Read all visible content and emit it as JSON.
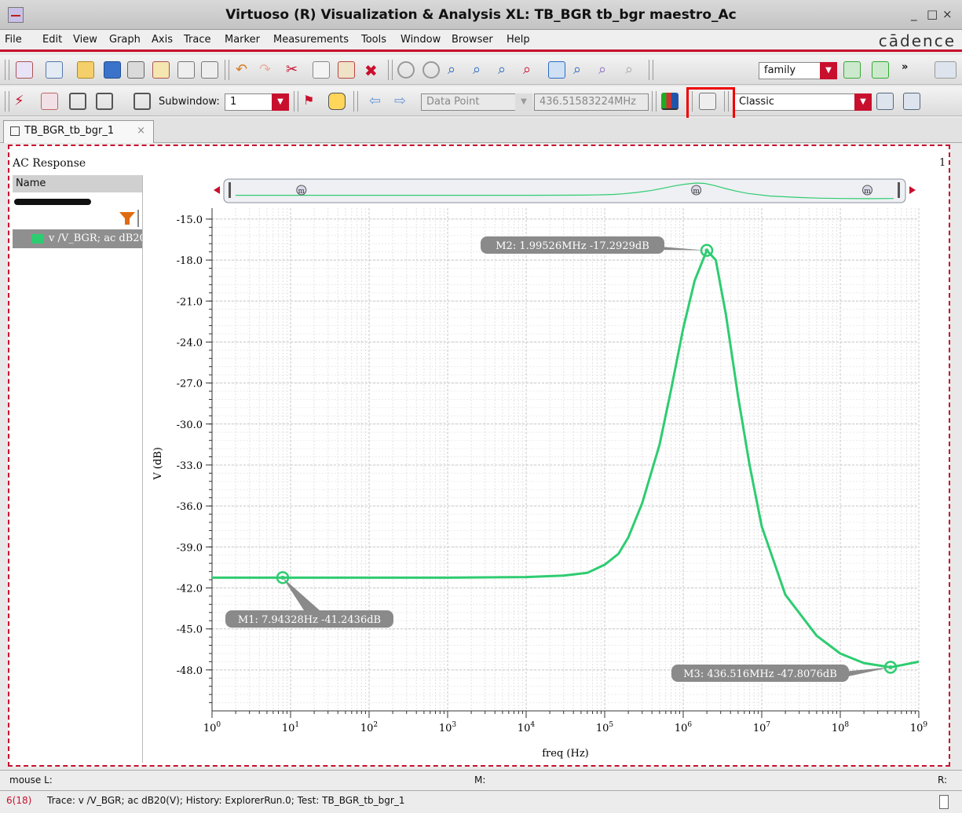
{
  "window": {
    "title": "Virtuoso (R) Visualization & Analysis XL: TB_BGR tb_bgr maestro_Ac",
    "controls": [
      "_",
      "□",
      "×"
    ]
  },
  "menu": [
    "File",
    "Edit",
    "View",
    "Graph",
    "Axis",
    "Trace",
    "Marker",
    "Measurements",
    "Tools",
    "Window",
    "Browser",
    "Help"
  ],
  "brand": "cādence",
  "toolbar": {
    "family_value": "family",
    "more_label": "»",
    "subwindow_label": "Subwindow:",
    "subwindow_value": "1",
    "datapoint_value": "Data Point",
    "frequency_value": "436.51583224MHz",
    "style_value": "Classic"
  },
  "tab": {
    "label": "TB_BGR_tb_bgr_1",
    "close": "×"
  },
  "panel": {
    "title": "AC Response",
    "name_header": "Name",
    "trace_label": "v /V_BGR; ac dB20",
    "page_number": "1"
  },
  "colors": {
    "trace": "#2ecc71",
    "accent": "#c8102e",
    "marker_label_bg": "#8a8a8a"
  },
  "chart_data": {
    "type": "line",
    "xlabel": "freq (Hz)",
    "ylabel": "V (dB)",
    "xscale": "log",
    "xlim": [
      1,
      1000000000
    ],
    "ylim": [
      -51,
      -14.2
    ],
    "yticks": [
      "-15.0",
      "-18.0",
      "-21.0",
      "-24.0",
      "-27.0",
      "-30.0",
      "-33.0",
      "-36.0",
      "-39.0",
      "-42.0",
      "-45.0",
      "-48.0"
    ],
    "xtick_bases": [
      "10",
      "10",
      "10",
      "10",
      "10",
      "10",
      "10",
      "10",
      "10",
      "10"
    ],
    "xtick_exps": [
      "0",
      "1",
      "2",
      "3",
      "4",
      "5",
      "6",
      "7",
      "8",
      "9"
    ],
    "grid": true,
    "series": [
      {
        "name": "v /V_BGR; ac dB20",
        "x": [
          1,
          10,
          100,
          1000,
          10000,
          30000,
          60000,
          100000,
          150000,
          200000,
          300000,
          500000,
          700000,
          1000000,
          1400000,
          1995260,
          2600000,
          3500000,
          5000000,
          7000000,
          10000000,
          20000000,
          50000000,
          100000000,
          200000000,
          436516000,
          1000000000
        ],
        "y": [
          -41.25,
          -41.25,
          -41.25,
          -41.25,
          -41.2,
          -41.1,
          -40.9,
          -40.3,
          -39.5,
          -38.3,
          -35.8,
          -31.5,
          -27.5,
          -23.0,
          -19.5,
          -17.29,
          -18.0,
          -22.0,
          -28.0,
          -33.0,
          -37.5,
          -42.5,
          -45.5,
          -46.8,
          -47.5,
          -47.81,
          -47.4
        ]
      }
    ],
    "markers": [
      {
        "label": "M1: 7.94328Hz -41.2436dB",
        "x": 7.94328,
        "y": -41.2436
      },
      {
        "label": "M2: 1.99526MHz -17.2929dB",
        "x": 1995260,
        "y": -17.2929
      },
      {
        "label": "M3: 436.516MHz -47.8076dB",
        "x": 436516000,
        "y": -47.8076
      }
    ],
    "overview_marker_label": "m"
  },
  "status": {
    "mouse_label": "mouse L:",
    "m_label": "M:",
    "r_label": "R:",
    "count": "6(18)",
    "trace_info": "Trace: v /V_BGR; ac dB20(V); History: ExplorerRun.0; Test: TB_BGR_tb_bgr_1"
  }
}
